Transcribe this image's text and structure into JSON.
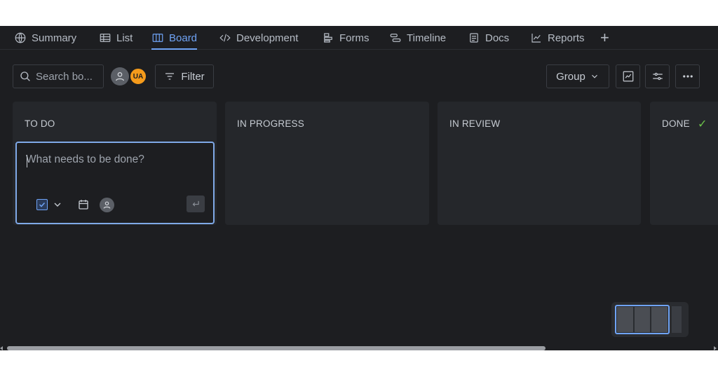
{
  "nav": {
    "tabs": [
      {
        "label": "Summary",
        "icon": "globe-icon"
      },
      {
        "label": "List",
        "icon": "list-table-icon"
      },
      {
        "label": "Board",
        "icon": "board-columns-icon",
        "active": true
      },
      {
        "label": "Development",
        "icon": "code-icon"
      },
      {
        "label": "Forms",
        "icon": "forms-icon"
      },
      {
        "label": "Timeline",
        "icon": "timeline-icon"
      },
      {
        "label": "Docs",
        "icon": "document-icon"
      },
      {
        "label": "Reports",
        "icon": "chart-line-icon"
      }
    ],
    "add_icon": "plus-icon"
  },
  "toolbar": {
    "search_placeholder": "Search bo...",
    "avatar_initials": "UA",
    "filter_label": "Filter",
    "group_label": "Group",
    "icons": [
      "insights-icon",
      "view-settings-icon",
      "more-icon"
    ]
  },
  "columns": [
    {
      "title": "TO DO"
    },
    {
      "title": "IN PROGRESS"
    },
    {
      "title": "IN REVIEW"
    },
    {
      "title": "DONE",
      "done_icon": "check-icon"
    }
  ],
  "create_card": {
    "placeholder": "What needs to be done?"
  },
  "colors": {
    "background": "#1d1e21",
    "column": "#25272b",
    "accent": "#6fa3f5",
    "avatar_ua": "#f59b1b",
    "done_check": "#6cc24a"
  }
}
